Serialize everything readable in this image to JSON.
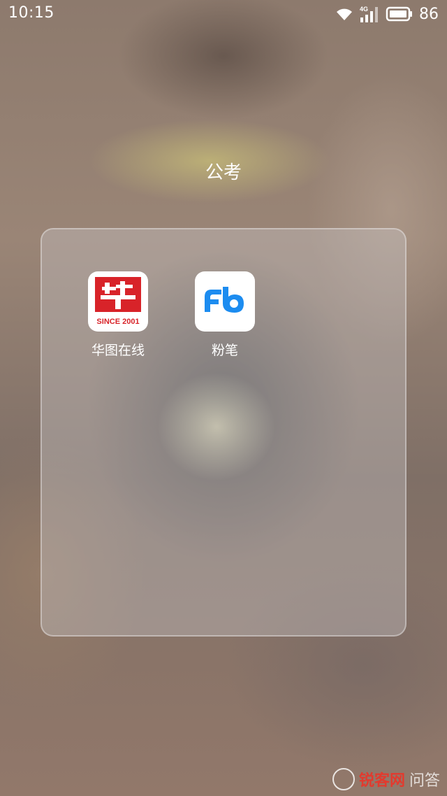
{
  "status_bar": {
    "time": "10:15",
    "network_type": "4G",
    "battery_percent": "86",
    "wifi_icon": "wifi-icon",
    "signal_icon": "cellular-signal-icon",
    "battery_icon": "battery-icon"
  },
  "folder": {
    "title": "公考",
    "apps": [
      {
        "label": "华图在线",
        "icon": "huatu-app-icon",
        "icon_text": "SINCE 2001",
        "brand_color": "#d82329"
      },
      {
        "label": "粉笔",
        "icon": "fenbi-app-icon",
        "brand_color": "#1c8cf0"
      }
    ]
  },
  "watermark": {
    "brand": "锐客网",
    "extra": "问答"
  }
}
